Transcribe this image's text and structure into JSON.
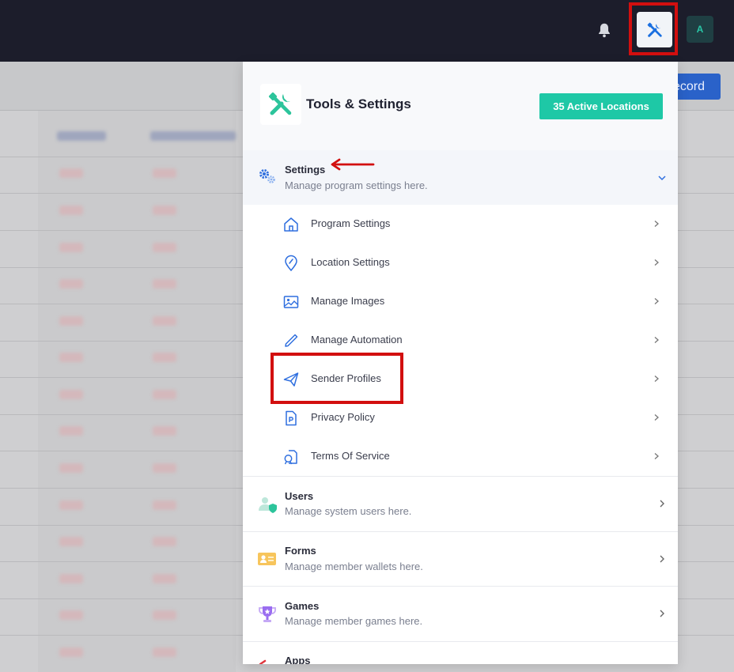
{
  "topbar": {
    "avatar_initial": "A",
    "icons": [
      "bell-icon",
      "tools-icon"
    ]
  },
  "background": {
    "record_button_label": "ecord"
  },
  "panel": {
    "title": "Tools & Settings",
    "active_locations_label": "35 Active Locations",
    "sections": [
      {
        "title": "Settings",
        "description": "Manage program settings here.",
        "icon": "gears-icon",
        "expanded": true,
        "items": [
          {
            "label": "Program Settings",
            "icon": "home-icon"
          },
          {
            "label": "Location Settings",
            "icon": "location-pin-icon"
          },
          {
            "label": "Manage Images",
            "icon": "image-icon"
          },
          {
            "label": "Manage Automation",
            "icon": "pencil-icon"
          },
          {
            "label": "Sender Profiles",
            "icon": "paper-plane-icon"
          },
          {
            "label": "Privacy Policy",
            "icon": "document-p-icon"
          },
          {
            "label": "Terms Of Service",
            "icon": "terms-icon"
          }
        ]
      },
      {
        "title": "Users",
        "description": "Manage system users here.",
        "icon": "users-shield-icon"
      },
      {
        "title": "Forms",
        "description": "Manage member wallets here.",
        "icon": "id-card-icon"
      },
      {
        "title": "Games",
        "description": "Manage member games here.",
        "icon": "trophy-icon"
      },
      {
        "title": "Apps",
        "description": "",
        "icon": "apps-icon"
      }
    ]
  },
  "colors": {
    "topbar": "#1c1d2b",
    "accent": "#1ec8a6",
    "highlight": "#d20f0f",
    "link_blue": "#2f6fdf"
  }
}
